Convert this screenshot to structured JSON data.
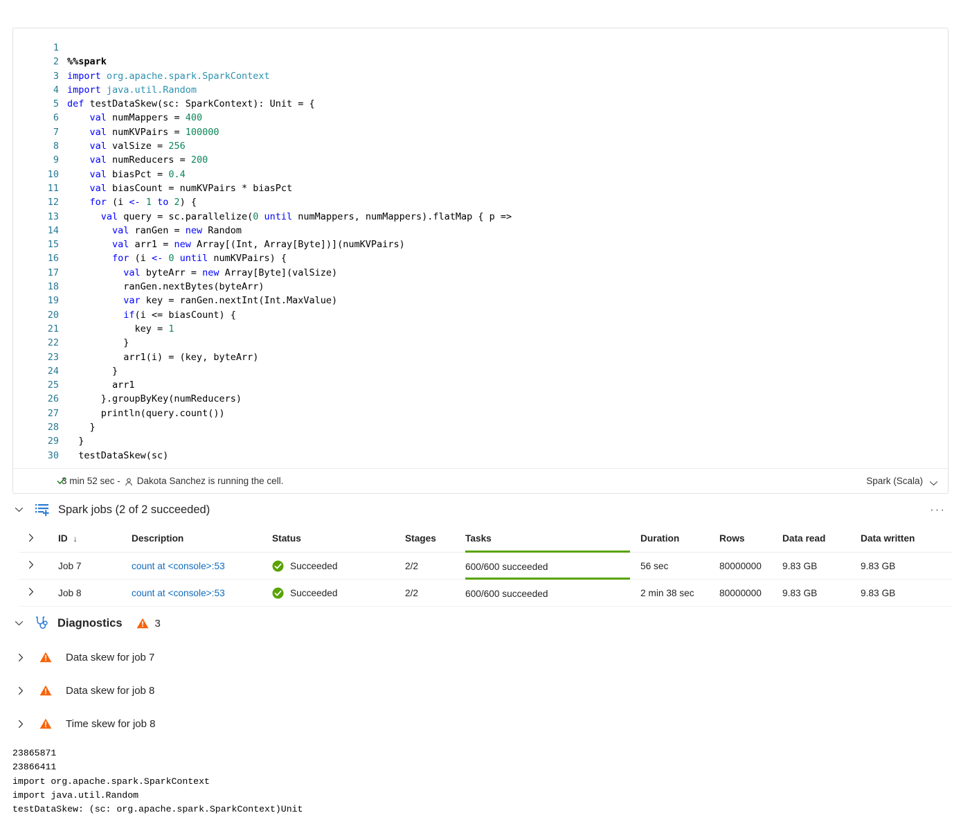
{
  "cell": {
    "language": "Spark (Scala)",
    "status": {
      "duration": "3 min 52 sec -",
      "user_message": "Dakota Sanchez is running the cell."
    },
    "code_lines": [
      {
        "n": "1",
        "tokens": []
      },
      {
        "n": "2",
        "tokens": [
          {
            "t": "magic",
            "s": "%%spark"
          }
        ]
      },
      {
        "n": "3",
        "tokens": [
          {
            "t": "kw",
            "s": "import"
          },
          {
            "t": "plain",
            "s": " "
          },
          {
            "t": "ns",
            "s": "org.apache.spark.SparkContext"
          }
        ]
      },
      {
        "n": "4",
        "tokens": [
          {
            "t": "kw",
            "s": "import"
          },
          {
            "t": "plain",
            "s": " "
          },
          {
            "t": "ns",
            "s": "java.util.Random"
          }
        ]
      },
      {
        "n": "5",
        "tokens": [
          {
            "t": "kw",
            "s": "def"
          },
          {
            "t": "plain",
            "s": " testDataSkew(sc: SparkContext): Unit = {"
          }
        ]
      },
      {
        "n": "6",
        "tokens": [
          {
            "t": "plain",
            "s": "    "
          },
          {
            "t": "kw",
            "s": "val"
          },
          {
            "t": "plain",
            "s": " numMappers = "
          },
          {
            "t": "num",
            "s": "400"
          }
        ]
      },
      {
        "n": "7",
        "tokens": [
          {
            "t": "plain",
            "s": "    "
          },
          {
            "t": "kw",
            "s": "val"
          },
          {
            "t": "plain",
            "s": " numKVPairs = "
          },
          {
            "t": "num",
            "s": "100000"
          }
        ]
      },
      {
        "n": "8",
        "tokens": [
          {
            "t": "plain",
            "s": "    "
          },
          {
            "t": "kw",
            "s": "val"
          },
          {
            "t": "plain",
            "s": " valSize = "
          },
          {
            "t": "num",
            "s": "256"
          }
        ]
      },
      {
        "n": "9",
        "tokens": [
          {
            "t": "plain",
            "s": "    "
          },
          {
            "t": "kw",
            "s": "val"
          },
          {
            "t": "plain",
            "s": " numReducers = "
          },
          {
            "t": "num",
            "s": "200"
          }
        ]
      },
      {
        "n": "10",
        "tokens": [
          {
            "t": "plain",
            "s": "    "
          },
          {
            "t": "kw",
            "s": "val"
          },
          {
            "t": "plain",
            "s": " biasPct = "
          },
          {
            "t": "num",
            "s": "0.4"
          }
        ]
      },
      {
        "n": "11",
        "tokens": [
          {
            "t": "plain",
            "s": "    "
          },
          {
            "t": "kw",
            "s": "val"
          },
          {
            "t": "plain",
            "s": " biasCount = numKVPairs * biasPct"
          }
        ]
      },
      {
        "n": "12",
        "tokens": [
          {
            "t": "plain",
            "s": "    "
          },
          {
            "t": "kw",
            "s": "for"
          },
          {
            "t": "plain",
            "s": " (i "
          },
          {
            "t": "op",
            "s": "<-"
          },
          {
            "t": "plain",
            "s": " "
          },
          {
            "t": "num",
            "s": "1"
          },
          {
            "t": "plain",
            "s": " "
          },
          {
            "t": "op",
            "s": "to"
          },
          {
            "t": "plain",
            "s": " "
          },
          {
            "t": "num",
            "s": "2"
          },
          {
            "t": "plain",
            "s": ") {"
          }
        ]
      },
      {
        "n": "13",
        "tokens": [
          {
            "t": "plain",
            "s": "      "
          },
          {
            "t": "kw",
            "s": "val"
          },
          {
            "t": "plain",
            "s": " query = sc.parallelize("
          },
          {
            "t": "num",
            "s": "0"
          },
          {
            "t": "plain",
            "s": " "
          },
          {
            "t": "op",
            "s": "until"
          },
          {
            "t": "plain",
            "s": " numMappers, numMappers).flatMap { p =>"
          }
        ]
      },
      {
        "n": "14",
        "tokens": [
          {
            "t": "plain",
            "s": "        "
          },
          {
            "t": "kw",
            "s": "val"
          },
          {
            "t": "plain",
            "s": " ranGen = "
          },
          {
            "t": "kw",
            "s": "new"
          },
          {
            "t": "plain",
            "s": " Random"
          }
        ]
      },
      {
        "n": "15",
        "tokens": [
          {
            "t": "plain",
            "s": "        "
          },
          {
            "t": "kw",
            "s": "val"
          },
          {
            "t": "plain",
            "s": " arr1 = "
          },
          {
            "t": "kw",
            "s": "new"
          },
          {
            "t": "plain",
            "s": " Array[(Int, Array[Byte])](numKVPairs)"
          }
        ]
      },
      {
        "n": "16",
        "tokens": [
          {
            "t": "plain",
            "s": "        "
          },
          {
            "t": "kw",
            "s": "for"
          },
          {
            "t": "plain",
            "s": " (i "
          },
          {
            "t": "op",
            "s": "<-"
          },
          {
            "t": "plain",
            "s": " "
          },
          {
            "t": "num",
            "s": "0"
          },
          {
            "t": "plain",
            "s": " "
          },
          {
            "t": "op",
            "s": "until"
          },
          {
            "t": "plain",
            "s": " numKVPairs) {"
          }
        ]
      },
      {
        "n": "17",
        "tokens": [
          {
            "t": "plain",
            "s": "          "
          },
          {
            "t": "kw",
            "s": "val"
          },
          {
            "t": "plain",
            "s": " byteArr = "
          },
          {
            "t": "kw",
            "s": "new"
          },
          {
            "t": "plain",
            "s": " Array[Byte](valSize)"
          }
        ]
      },
      {
        "n": "18",
        "tokens": [
          {
            "t": "plain",
            "s": "          ranGen.nextBytes(byteArr)"
          }
        ]
      },
      {
        "n": "19",
        "tokens": [
          {
            "t": "plain",
            "s": "          "
          },
          {
            "t": "kw",
            "s": "var"
          },
          {
            "t": "plain",
            "s": " key = ranGen.nextInt(Int.MaxValue)"
          }
        ]
      },
      {
        "n": "20",
        "tokens": [
          {
            "t": "plain",
            "s": "          "
          },
          {
            "t": "kw",
            "s": "if"
          },
          {
            "t": "plain",
            "s": "(i <= biasCount) {"
          }
        ]
      },
      {
        "n": "21",
        "tokens": [
          {
            "t": "plain",
            "s": "            key = "
          },
          {
            "t": "num",
            "s": "1"
          }
        ]
      },
      {
        "n": "22",
        "tokens": [
          {
            "t": "plain",
            "s": "          }"
          }
        ]
      },
      {
        "n": "23",
        "tokens": [
          {
            "t": "plain",
            "s": "          arr1(i) = (key, byteArr)"
          }
        ]
      },
      {
        "n": "24",
        "tokens": [
          {
            "t": "plain",
            "s": "        }"
          }
        ]
      },
      {
        "n": "25",
        "tokens": [
          {
            "t": "plain",
            "s": "        arr1"
          }
        ]
      },
      {
        "n": "26",
        "tokens": [
          {
            "t": "plain",
            "s": "      }.groupByKey(numReducers)"
          }
        ]
      },
      {
        "n": "27",
        "tokens": [
          {
            "t": "plain",
            "s": "      println(query.count())"
          }
        ]
      },
      {
        "n": "28",
        "tokens": [
          {
            "t": "plain",
            "s": "    }"
          }
        ]
      },
      {
        "n": "29",
        "tokens": [
          {
            "t": "plain",
            "s": "  }"
          }
        ]
      },
      {
        "n": "30",
        "tokens": [
          {
            "t": "plain",
            "s": "  testDataSkew(sc)"
          }
        ]
      }
    ]
  },
  "spark_jobs": {
    "title": "Spark jobs (2 of 2 succeeded)",
    "kebab": "···",
    "columns": {
      "id": "ID",
      "sort_arrow": "↓",
      "description": "Description",
      "status": "Status",
      "stages": "Stages",
      "tasks": "Tasks",
      "duration": "Duration",
      "rows": "Rows",
      "data_read": "Data read",
      "data_written": "Data written"
    },
    "rows": [
      {
        "id": "Job 7",
        "description": "count at <console>:53",
        "status": "Succeeded",
        "stages": "2/2",
        "tasks": "600/600 succeeded",
        "tasks_pct": 100,
        "duration": "56 sec",
        "rows": "80000000",
        "data_read": "9.83 GB",
        "data_written": "9.83 GB"
      },
      {
        "id": "Job 8",
        "description": "count at <console>:53",
        "status": "Succeeded",
        "stages": "2/2",
        "tasks": "600/600 succeeded",
        "tasks_pct": 100,
        "duration": "2 min 38 sec",
        "rows": "80000000",
        "data_read": "9.83 GB",
        "data_written": "9.83 GB"
      }
    ]
  },
  "diagnostics": {
    "title": "Diagnostics",
    "warning_count": "3",
    "items": [
      {
        "label": "Data skew for job 7"
      },
      {
        "label": "Data skew for job 8"
      },
      {
        "label": "Time skew for job 8"
      }
    ]
  },
  "console_output": "23865871\n23866411\nimport org.apache.spark.SparkContext\nimport java.util.Random\ntestDataSkew: (sc: org.apache.spark.SparkContext)Unit",
  "colors": {
    "success_green": "#57a300",
    "warning_orange": "#f7630c",
    "link_blue": "#0f6cbd",
    "line_number": "#237893"
  }
}
